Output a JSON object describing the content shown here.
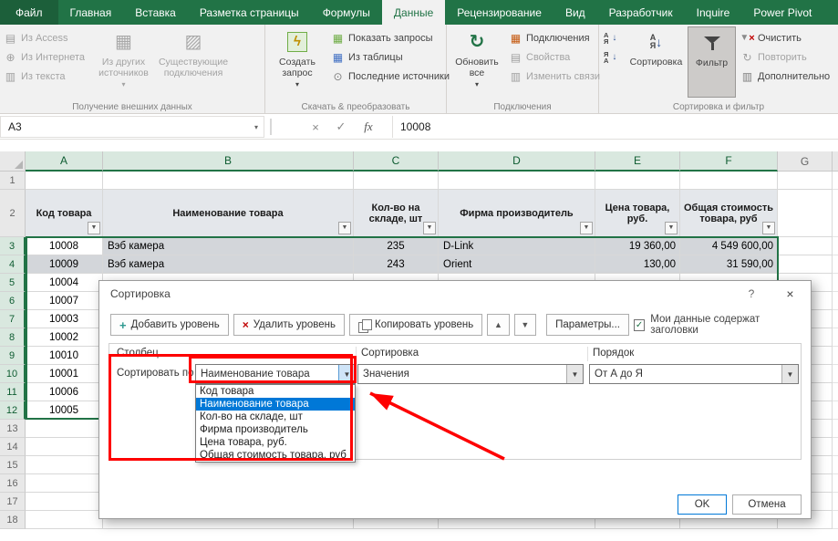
{
  "colors": {
    "excel_green": "#217346",
    "ribbon_bg": "#f1f1f1",
    "selection_fill": "#d3d6da",
    "selected_header_fill": "#d9e8df",
    "list_highlight_blue": "#0078d7",
    "annotation_red": "#fe0000"
  },
  "icons": {
    "dropdown_small": "▾",
    "combo_arrow": "▼",
    "up_arrow": "▲",
    "down_arrow": "▼",
    "close": "×",
    "help": "?",
    "check": "✓",
    "cancel_x": "×",
    "plus": "+",
    "fx": "fx",
    "db": "▤",
    "globe": "⊕",
    "doc": "▥",
    "grid": "▦",
    "diag": "▨",
    "lightning": "ϟ",
    "refresh": "↻",
    "clock": "⊙",
    "letter_a": "А",
    "letter_z": "Я",
    "arrow_down": "↓"
  },
  "ribbon": {
    "tabs": [
      "Файл",
      "Главная",
      "Вставка",
      "Разметка страницы",
      "Формулы",
      "Данные",
      "Рецензирование",
      "Вид",
      "Разработчик",
      "Inquire",
      "Power Pivot"
    ],
    "active_tab": "Данные",
    "groups": [
      {
        "label": "Получение внешних данных",
        "small": [
          "Из Access",
          "Из Интернета",
          "Из текста"
        ],
        "big": [
          "Из других источников",
          "Существующие подключения"
        ]
      },
      {
        "label": "Скачать & преобразовать",
        "big": [
          "Создать запрос"
        ],
        "small": [
          "Показать запросы",
          "Из таблицы",
          "Последние источники"
        ]
      },
      {
        "label": "Подключения",
        "big": [
          "Обновить все"
        ],
        "small": [
          "Подключения",
          "Свойства",
          "Изменить связи"
        ]
      },
      {
        "label": "Сортировка и фильтр",
        "big": [
          "Сортировка",
          "Фильтр"
        ],
        "small": [
          "Очистить",
          "Повторить",
          "Дополнительно"
        ]
      }
    ]
  },
  "formula_bar": {
    "name_box": "A3",
    "value": "10008"
  },
  "sheet": {
    "col_headers": [
      "A",
      "B",
      "C",
      "D",
      "E",
      "F",
      "G"
    ],
    "row_numbers": [
      "1",
      "2",
      "3",
      "4",
      "5",
      "6",
      "7",
      "8",
      "9",
      "10",
      "11",
      "12",
      "13",
      "14",
      "15",
      "16",
      "17",
      "18"
    ],
    "headers": {
      "a": "Код товара",
      "b": "Наименование товара",
      "c": "Кол-во на складе, шт",
      "d": "Фирма производитель",
      "e": "Цена товара, руб.",
      "f": "Общая стоимость товара, руб"
    },
    "row3": {
      "a": "10008",
      "b": "Вэб камера",
      "c": "235",
      "d": "D-Link",
      "e": "19 360,00",
      "f": "4 549 600,00"
    },
    "row4": {
      "a": "10009",
      "b": "Вэб камера",
      "c": "243",
      "d": "Orient",
      "e": "130,00",
      "f": "31 590,00"
    },
    "col_a": [
      "10004",
      "10007",
      "10003",
      "10002",
      "10010",
      "10001",
      "10006",
      "10005"
    ]
  },
  "dialog": {
    "title": "Сортировка",
    "toolbar": {
      "add": "Добавить уровень",
      "remove": "Удалить уровень",
      "copy": "Копировать уровень",
      "options": "Параметры...",
      "checkbox": "Мои данные содержат заголовки",
      "checkbox_checked": true
    },
    "columns": {
      "column": "Столбец",
      "sort": "Сортировка",
      "order": "Порядок"
    },
    "criteria": {
      "label": "Сортировать по",
      "column_value": "Наименование товара",
      "sort_value": "Значения",
      "order_value": "От А до Я"
    },
    "dropdown_items": [
      "Код товара",
      "Наименование товара",
      "Кол-во на складе, шт",
      "Фирма производитель",
      "Цена товара, руб.",
      "Общая стоимость товара, руб"
    ],
    "selected_item": "Наименование товара",
    "ok": "OK",
    "cancel": "Отмена"
  }
}
